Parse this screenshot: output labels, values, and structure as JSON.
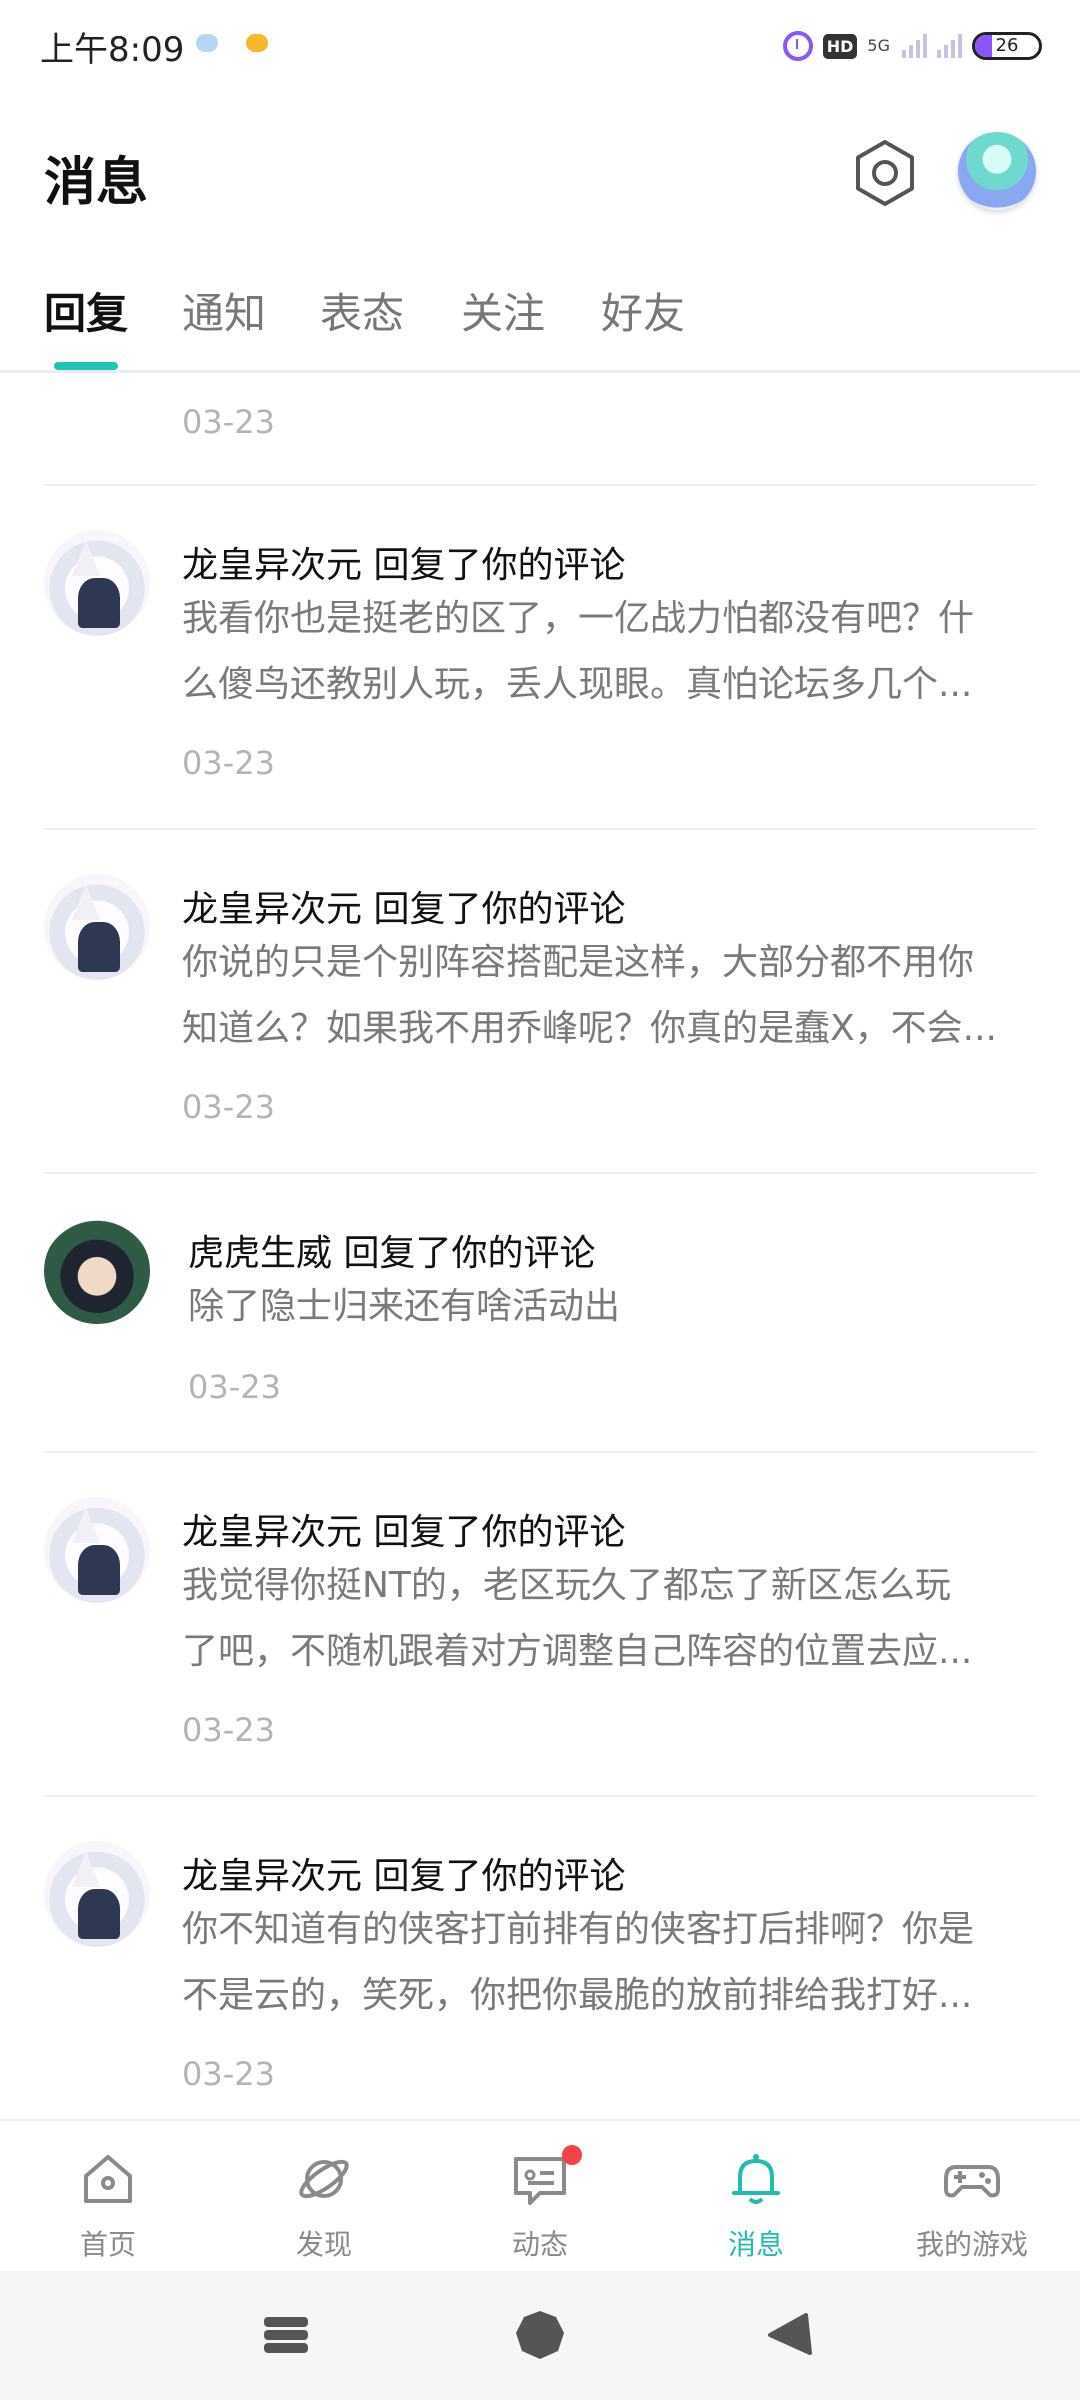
{
  "status_bar": {
    "time": "上午8:09",
    "hd": "HD",
    "network": "5G",
    "battery": "26",
    "battery_level": 0.26,
    "colors": {
      "accent": "#8a55ff"
    }
  },
  "header": {
    "title": "消息",
    "settings_icon": "hexagon-gear-icon",
    "avatar_icon": "user-avatar"
  },
  "tabs": [
    {
      "label": "回复",
      "active": true
    },
    {
      "label": "通知",
      "active": false
    },
    {
      "label": "表态",
      "active": false
    },
    {
      "label": "关注",
      "active": false
    },
    {
      "label": "好友",
      "active": false
    }
  ],
  "list": {
    "top_date": "03-23",
    "items": [
      {
        "avatar": "fox-girl-avatar",
        "title": "龙皇异次元 回复了你的评论",
        "body_lines": [
          "我看你也是挺老的区了，一亿战力怕都没有吧？什",
          "么傻鸟还教别人玩，丢人现眼。真怕论坛多几个..."
        ],
        "date": "03-23"
      },
      {
        "avatar": "fox-girl-avatar",
        "title": "龙皇异次元 回复了你的评论",
        "body_lines": [
          "你说的只是个别阵容搭配是这样，大部分都不用你",
          "知道么？如果我不用乔峰呢？你真的是蠢X，不会..."
        ],
        "date": "03-23"
      },
      {
        "avatar": "bard-boy-avatar",
        "title": "虎虎生威 回复了你的评论",
        "body_lines": [
          "除了隐士归来还有啥活动出"
        ],
        "date": "03-23"
      },
      {
        "avatar": "fox-girl-avatar",
        "title": "龙皇异次元 回复了你的评论",
        "body_lines": [
          "我觉得你挺NT的，老区玩久了都忘了新区怎么玩",
          "了吧，不随机跟着对方调整自己阵容的位置去应..."
        ],
        "date": "03-23"
      },
      {
        "avatar": "fox-girl-avatar",
        "title": "龙皇异次元 回复了你的评论",
        "body_lines": [
          "你不知道有的侠客打前排有的侠客打后排啊？你是",
          "不是云的，笑死，你把你最脆的放前排给我打好..."
        ],
        "date": "03-23"
      }
    ]
  },
  "bottom_nav": [
    {
      "label": "首页",
      "icon": "home-icon",
      "active": false
    },
    {
      "label": "发现",
      "icon": "planet-icon",
      "active": false
    },
    {
      "label": "动态",
      "icon": "message-icon",
      "active": false,
      "badge": true
    },
    {
      "label": "消息",
      "icon": "bell-icon",
      "active": true
    },
    {
      "label": "我的游戏",
      "icon": "gamepad-icon",
      "active": false
    }
  ],
  "colors": {
    "accent": "#1fc4b8",
    "badge": "#f2434a"
  }
}
